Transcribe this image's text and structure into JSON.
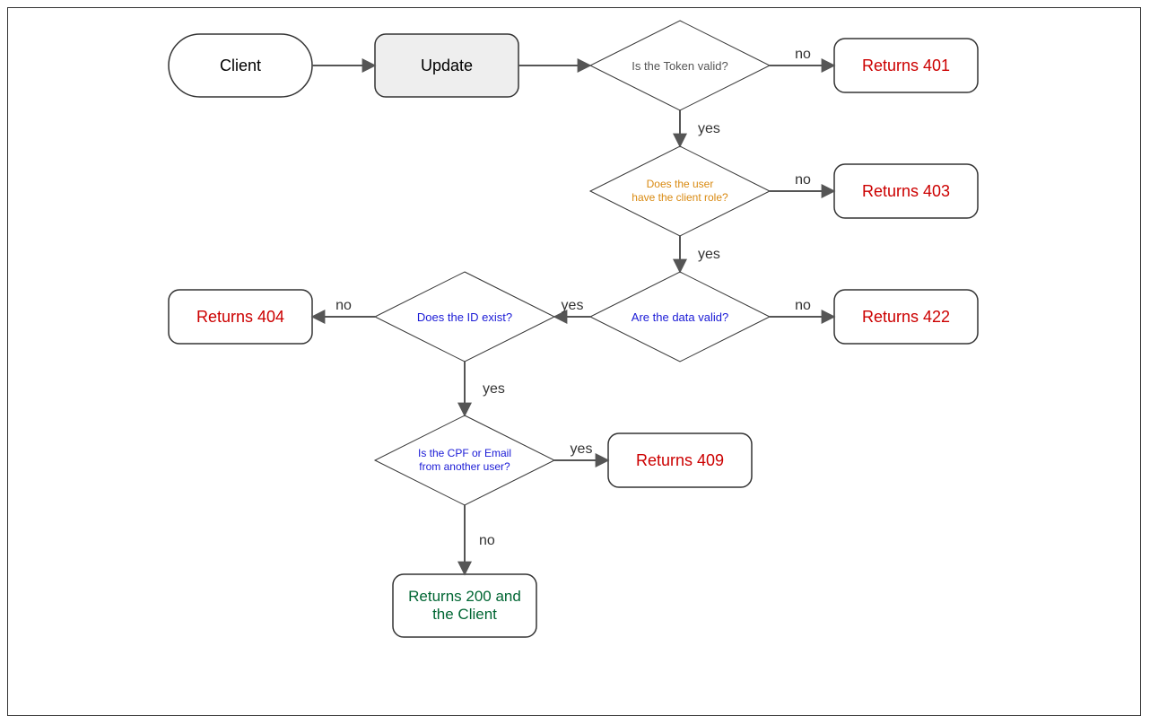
{
  "nodes": {
    "client": {
      "label": "Client"
    },
    "update": {
      "label": "Update"
    },
    "token_valid": {
      "label": "Is the Token valid?"
    },
    "returns_401": {
      "label": "Returns 401"
    },
    "user_role": {
      "line1": "Does the user",
      "line2": "have the client role?"
    },
    "returns_403": {
      "label": "Returns 403"
    },
    "data_valid": {
      "label": "Are the data valid?"
    },
    "returns_422": {
      "label": "Returns 422"
    },
    "id_exist": {
      "label": "Does the ID exist?"
    },
    "returns_404": {
      "label": "Returns 404"
    },
    "cpf_email": {
      "line1": "Is the CPF or Email",
      "line2": "from another user?"
    },
    "returns_409": {
      "label": "Returns 409"
    },
    "returns_200": {
      "line1": "Returns 200 and",
      "line2": "the Client"
    }
  },
  "edges": {
    "yes": "yes",
    "no": "no"
  },
  "colors": {
    "stroke": "#333333",
    "arrow": "#555555",
    "fill_gray": "#eeeeee",
    "text_default": "#000000",
    "text_gray": "#555555",
    "text_orange": "#d98a12",
    "text_blue": "#1a1ad6",
    "text_red": "#cc0000",
    "text_green": "#006633",
    "edge_label": "#333333"
  }
}
